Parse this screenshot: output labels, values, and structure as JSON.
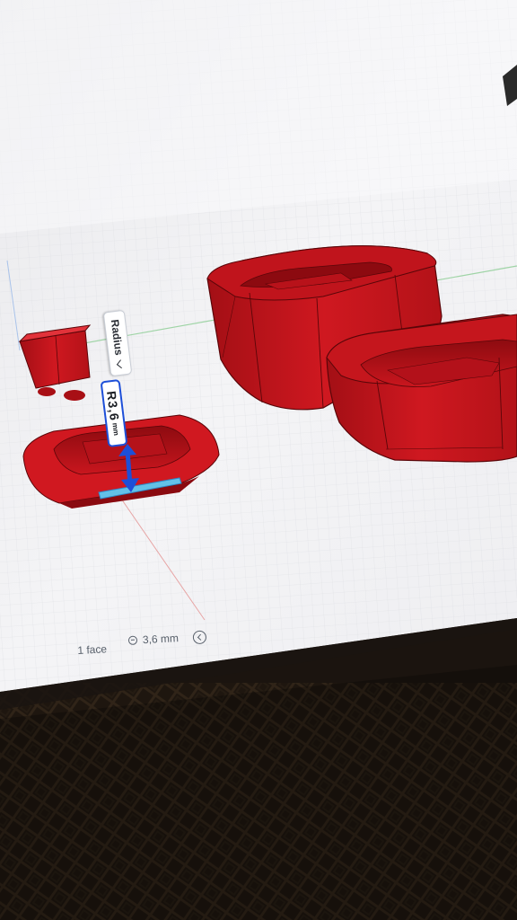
{
  "canvas": {
    "background": "#f1f1f3",
    "grid_color": "#dcdde2",
    "model_color": "#c3141b",
    "model_shadow": "#7c0a0f",
    "accent_blue": "#1d4fd8",
    "cloth_color": "#3b2a1c"
  },
  "dimension_tool": {
    "label": "Radius",
    "label_icon": "chevron-down-icon",
    "value": "R3,6",
    "unit": "mm",
    "handle_icon": "double-arrow-icon"
  },
  "status_bar": {
    "selection": "1 face",
    "distance_icon": "measure-icon",
    "distance": "3,6 mm",
    "back_icon": "chevron-left-icon"
  }
}
